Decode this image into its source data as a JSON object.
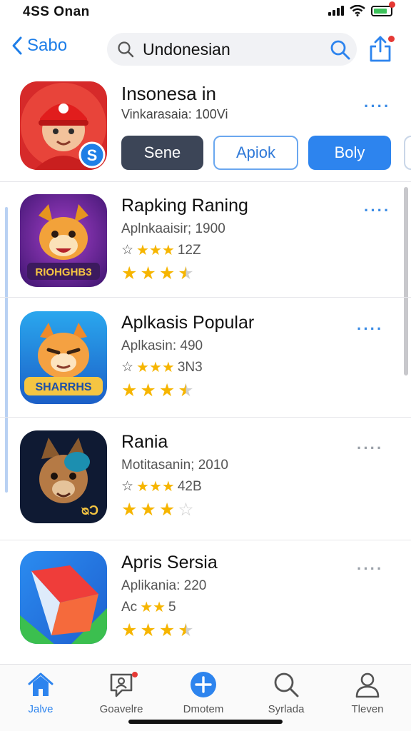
{
  "status": {
    "time": "4SS Onan"
  },
  "nav": {
    "back_label": "Sabo",
    "search_value": "Undonesian"
  },
  "featured": {
    "title": "Insonesa in",
    "subtitle": "Vinkarasaia: 100Vi",
    "buttons": [
      "Sene",
      "Apiok",
      "Boly"
    ]
  },
  "apps": [
    {
      "title": "Rapking Raning",
      "subtitle": "Aplnkaaisir; 1900",
      "rating_text": "12Z",
      "mini_stars": "★★★",
      "mini_prefix": "☆",
      "stars": 3.5,
      "art_text": "RIOHGHB3"
    },
    {
      "title": "Aplkasis Popular",
      "subtitle": "Aplkasin: 490",
      "rating_text": "3N3",
      "mini_stars": "★★★",
      "mini_prefix": "☆",
      "stars": 3.5,
      "art_text": "SHARRHS"
    },
    {
      "title": "Rania",
      "subtitle": "Motitasanin; 2010",
      "rating_text": "42B",
      "mini_stars": "★★★",
      "mini_prefix": "☆",
      "stars": 3,
      "art_text": "ᴓƆ"
    },
    {
      "title": "Apris Sersia",
      "subtitle": "Aplikania: 220",
      "rating_text": "5",
      "mini_stars": "★★",
      "mini_prefix": "Ac",
      "stars": 3.5,
      "art_text": ""
    }
  ],
  "tabs": [
    {
      "label": "Jalve",
      "icon": "home-icon",
      "active": true
    },
    {
      "label": "Goavelre",
      "icon": "chat-icon",
      "active": false
    },
    {
      "label": "Dmotem",
      "icon": "add-icon",
      "active": false
    },
    {
      "label": "Syrlada",
      "icon": "search-icon",
      "active": false
    },
    {
      "label": "Tleven",
      "icon": "profile-icon",
      "active": false
    }
  ],
  "colors": {
    "accent": "#2d84ee",
    "star": "#f6b500",
    "dark_button": "#3c4557"
  }
}
